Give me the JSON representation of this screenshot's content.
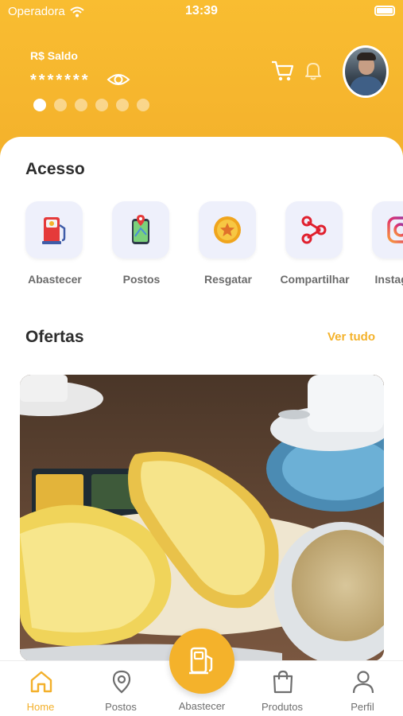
{
  "status_bar": {
    "carrier": "Operadora",
    "time": "13:39"
  },
  "header": {
    "balance_label": "R$ Saldo",
    "balance_masked": "*******",
    "carousel": {
      "count": 6,
      "active_index": 0
    }
  },
  "acesso": {
    "title": "Acesso",
    "items": [
      {
        "label": "Abastecer",
        "icon": "fuel-pump-icon"
      },
      {
        "label": "Postos",
        "icon": "map-pin-icon"
      },
      {
        "label": "Resgatar",
        "icon": "coin-star-icon"
      },
      {
        "label": "Compartilhar",
        "icon": "share-icon"
      },
      {
        "label": "Instagram",
        "icon": "instagram-icon"
      }
    ]
  },
  "ofertas": {
    "title": "Ofertas",
    "see_all": "Ver tudo"
  },
  "tabbar": {
    "items": [
      {
        "label": "Home",
        "icon": "home-icon",
        "active": true
      },
      {
        "label": "Postos",
        "icon": "location-pin-icon",
        "active": false
      },
      {
        "label": "Abastecer",
        "icon": "fuel-pump-icon",
        "active": false
      },
      {
        "label": "Produtos",
        "icon": "shopping-bag-icon",
        "active": false
      },
      {
        "label": "Perfil",
        "icon": "user-icon",
        "active": false
      }
    ]
  },
  "colors": {
    "primary": "#f4b22b",
    "tile_bg": "#eef0fb",
    "text_dark": "#2d2d2d",
    "text_muted": "#6b6b6b"
  }
}
